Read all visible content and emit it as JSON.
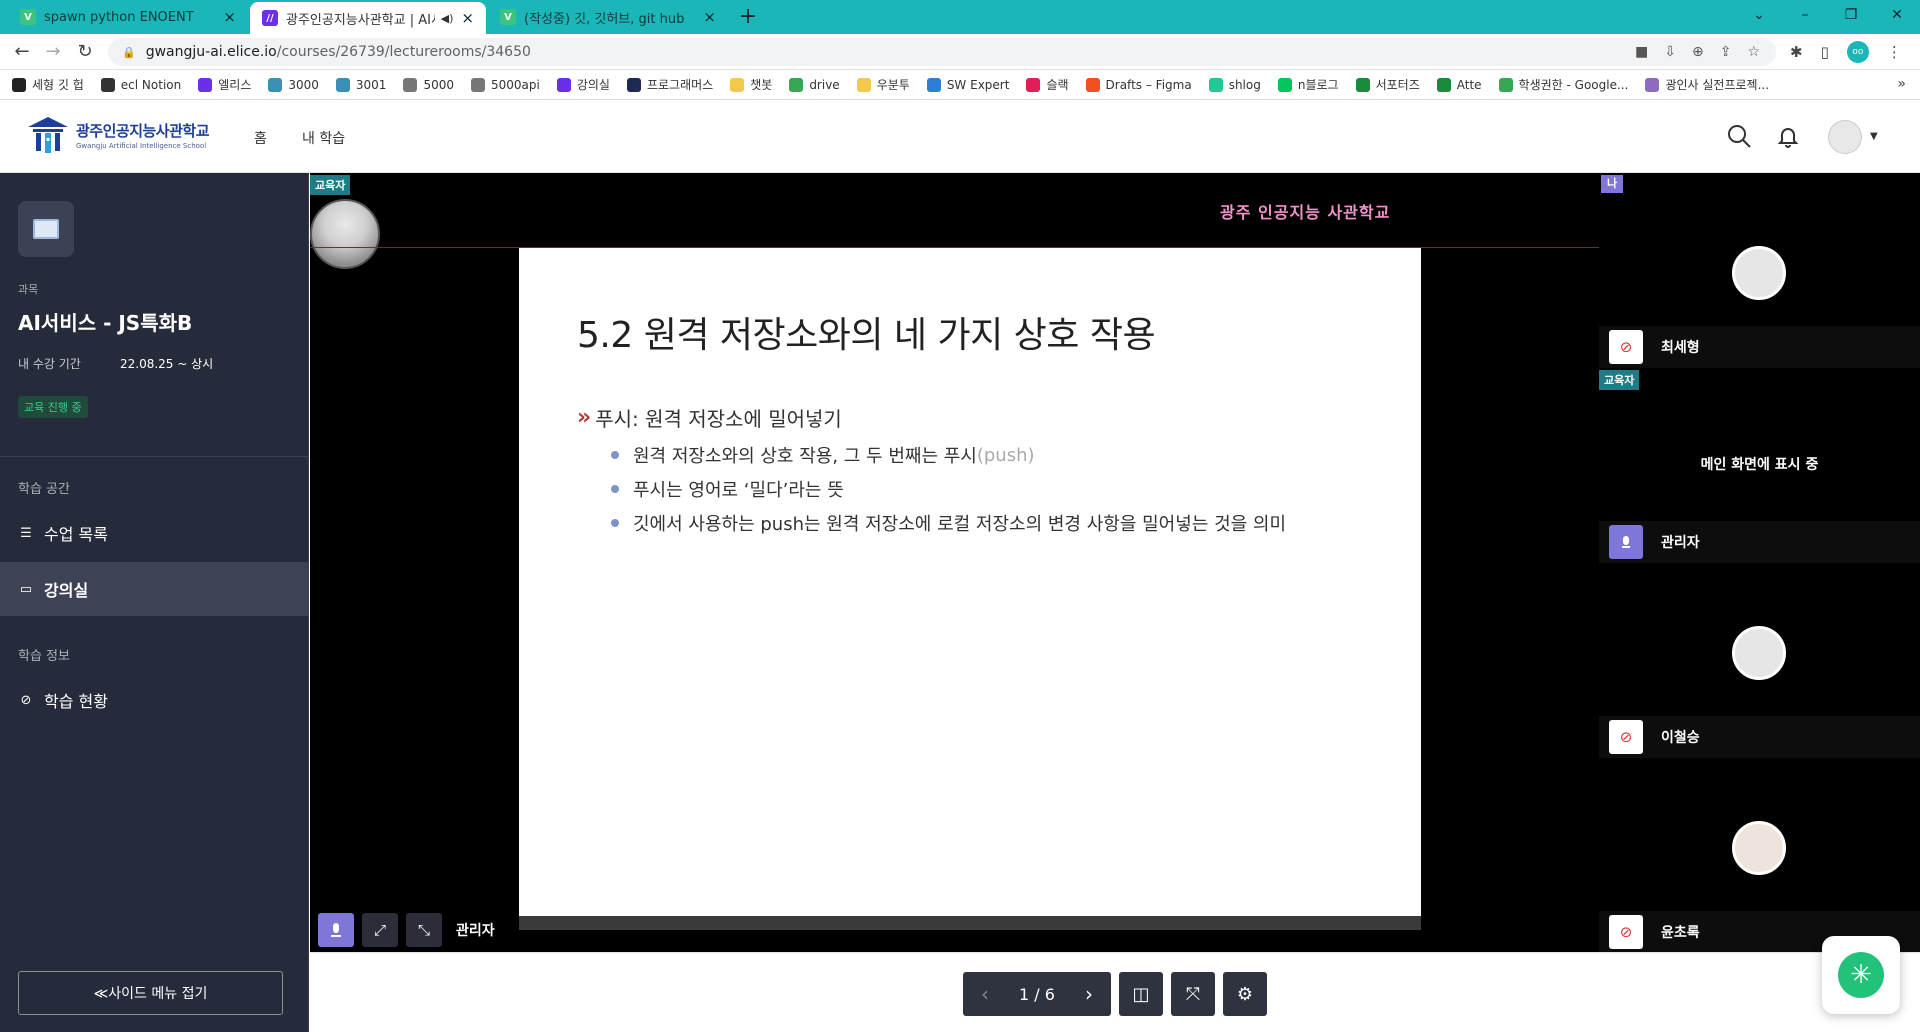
{
  "browser": {
    "tabs": [
      {
        "title": "spawn python ENOENT",
        "favicon": "V",
        "active": false
      },
      {
        "title": "광주인공지능사관학교 | AI서",
        "favicon": "//",
        "active": true
      },
      {
        "title": "(작성중) 깃, 깃허브, git hub",
        "favicon": "V",
        "active": false
      }
    ],
    "url_domain": "gwangju-ai.elice.io",
    "url_path": "/courses/26739/lecturerooms/34650",
    "bookmarks": [
      {
        "label": "세형 깃 헙",
        "icon": "github-icon",
        "color": "#222222"
      },
      {
        "label": "ecl Notion",
        "icon": "notion-icon",
        "color": "#333333"
      },
      {
        "label": "엘리스",
        "icon": "elice-icon",
        "color": "#6b2ee9"
      },
      {
        "label": "3000",
        "icon": "react-icon",
        "color": "#3a8fb7"
      },
      {
        "label": "3001",
        "icon": "react-icon",
        "color": "#3a8fb7"
      },
      {
        "label": "5000",
        "icon": "globe-icon",
        "color": "#777777"
      },
      {
        "label": "5000api",
        "icon": "globe-icon",
        "color": "#777777"
      },
      {
        "label": "강의실",
        "icon": "elice-icon",
        "color": "#6b2ee9"
      },
      {
        "label": "프로그래머스",
        "icon": "programmers-icon",
        "color": "#1e2a52"
      },
      {
        "label": "챗봇",
        "icon": "folder-icon",
        "color": "#f2c94c"
      },
      {
        "label": "drive",
        "icon": "drive-icon",
        "color": "#34a853"
      },
      {
        "label": "우분투",
        "icon": "folder-icon",
        "color": "#f2c94c"
      },
      {
        "label": "SW Expert",
        "icon": "swexpert-icon",
        "color": "#2d7fd3"
      },
      {
        "label": "슬랙",
        "icon": "slack-icon",
        "color": "#e01e5a"
      },
      {
        "label": "Drafts – Figma",
        "icon": "figma-icon",
        "color": "#f24e1e"
      },
      {
        "label": "shlog",
        "icon": "velog-icon",
        "color": "#20c997"
      },
      {
        "label": "n블로그",
        "icon": "naver-blog-icon",
        "color": "#03c75a"
      },
      {
        "label": "서포터즈",
        "icon": "plus-icon",
        "color": "#1a8b3c"
      },
      {
        "label": "Atte",
        "icon": "plus-icon",
        "color": "#1a8b3c"
      },
      {
        "label": "학생권한 - Google...",
        "icon": "drive-icon",
        "color": "#34a853"
      },
      {
        "label": "광인사 실전프로젝...",
        "icon": "mail-icon",
        "color": "#8e6bbf"
      }
    ]
  },
  "site": {
    "logo_ko": "광주인공지능사관학교",
    "logo_en": "Gwangju Artificial Intelligence School",
    "nav": [
      "홈",
      "내 학습"
    ]
  },
  "sidebar": {
    "subject_label": "과목",
    "course_name": "AI서비스 - JS특화B",
    "period_label": "내 수강 기간",
    "period_value": "22.08.25 ~ 상시",
    "status": "교육 진행 중",
    "section_space": "학습 공간",
    "items_space": [
      {
        "label": "수업 목록",
        "icon": "list-icon",
        "active": false
      },
      {
        "label": "강의실",
        "icon": "monitor-icon",
        "active": true
      }
    ],
    "section_info": "학습 정보",
    "items_info": [
      {
        "label": "학습 현황",
        "icon": "check-circle-icon",
        "active": false
      }
    ],
    "collapse_label": "≪사이드 메뉴 접기"
  },
  "stage": {
    "presenter_badge": "교육자",
    "brand_text": "광주 인공지능 사관학교",
    "presenter_name": "관리자",
    "slide": {
      "title": "5.2 원격 저장소와의 네 가지 상호 작용",
      "bullet_marker": "»",
      "heading": "푸시: 원격 저장소에 밀어넣기",
      "sub_bullets": [
        {
          "text": "원격 저장소와의 상호 작용, 그 두 번째는 푸시",
          "muted": "(push)"
        },
        {
          "text": "푸시는 영어로 ‘밀다’라는 뜻",
          "muted": ""
        },
        {
          "text": "깃에서 사용하는 push는 원격 저장소에 로컬 저장소의 변경 사항을 밀어넣는 것을 의미",
          "muted": ""
        }
      ]
    }
  },
  "participants": {
    "me_badge": "나",
    "educator_badge": "교육자",
    "main_screen_text": "메인 화면에 표시 중",
    "tiles": [
      {
        "name": "최세형",
        "mic": "muted",
        "is_me": true
      },
      {
        "name": "관리자",
        "mic": "on",
        "is_educator": true
      },
      {
        "name": "이철승",
        "mic": "muted"
      },
      {
        "name": "윤초록",
        "mic": "muted"
      }
    ]
  },
  "pager": {
    "page_text": "1 / 6",
    "current": 1,
    "total": 6
  },
  "colors": {
    "tab_strip": "#1ab6b8",
    "sidebar_bg": "#262b3b",
    "accent_purple": "#7e76d8",
    "status_green": "#3ad08a",
    "brand_pink": "#f391c9",
    "fab_green": "#23c27a"
  }
}
